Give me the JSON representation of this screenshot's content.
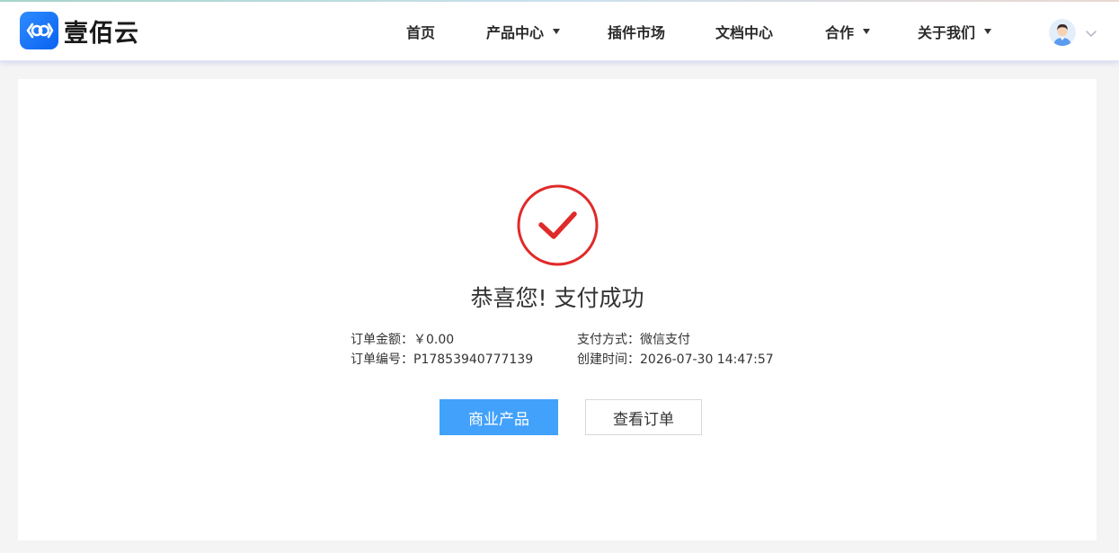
{
  "brand": {
    "name": "壹佰云",
    "accent": "#1e78ff"
  },
  "nav": {
    "home": "首页",
    "products": "产品中心",
    "plugins": "插件市场",
    "docs": "文档中心",
    "cooperation": "合作",
    "about": "关于我们"
  },
  "result": {
    "title": "恭喜您! 支付成功",
    "status_color": "#e02a2a",
    "amount_label": "订单金额：",
    "amount_value": "￥0.00",
    "order_no_label": "订单编号：",
    "order_no_value": "P17853940777139",
    "pay_method_label": "支付方式：",
    "pay_method_value": "微信支付",
    "created_label": "创建时间：",
    "created_value": "2026-07-30 14:47:57"
  },
  "actions": {
    "products_button": "商业产品",
    "orders_button": "查看订单",
    "primary_color": "#42a1fb"
  },
  "icons": {
    "logo": "infinity-logo-icon",
    "success": "check-circle-icon",
    "user": "user-avatar-icon",
    "chevron": "chevron-down-icon"
  }
}
